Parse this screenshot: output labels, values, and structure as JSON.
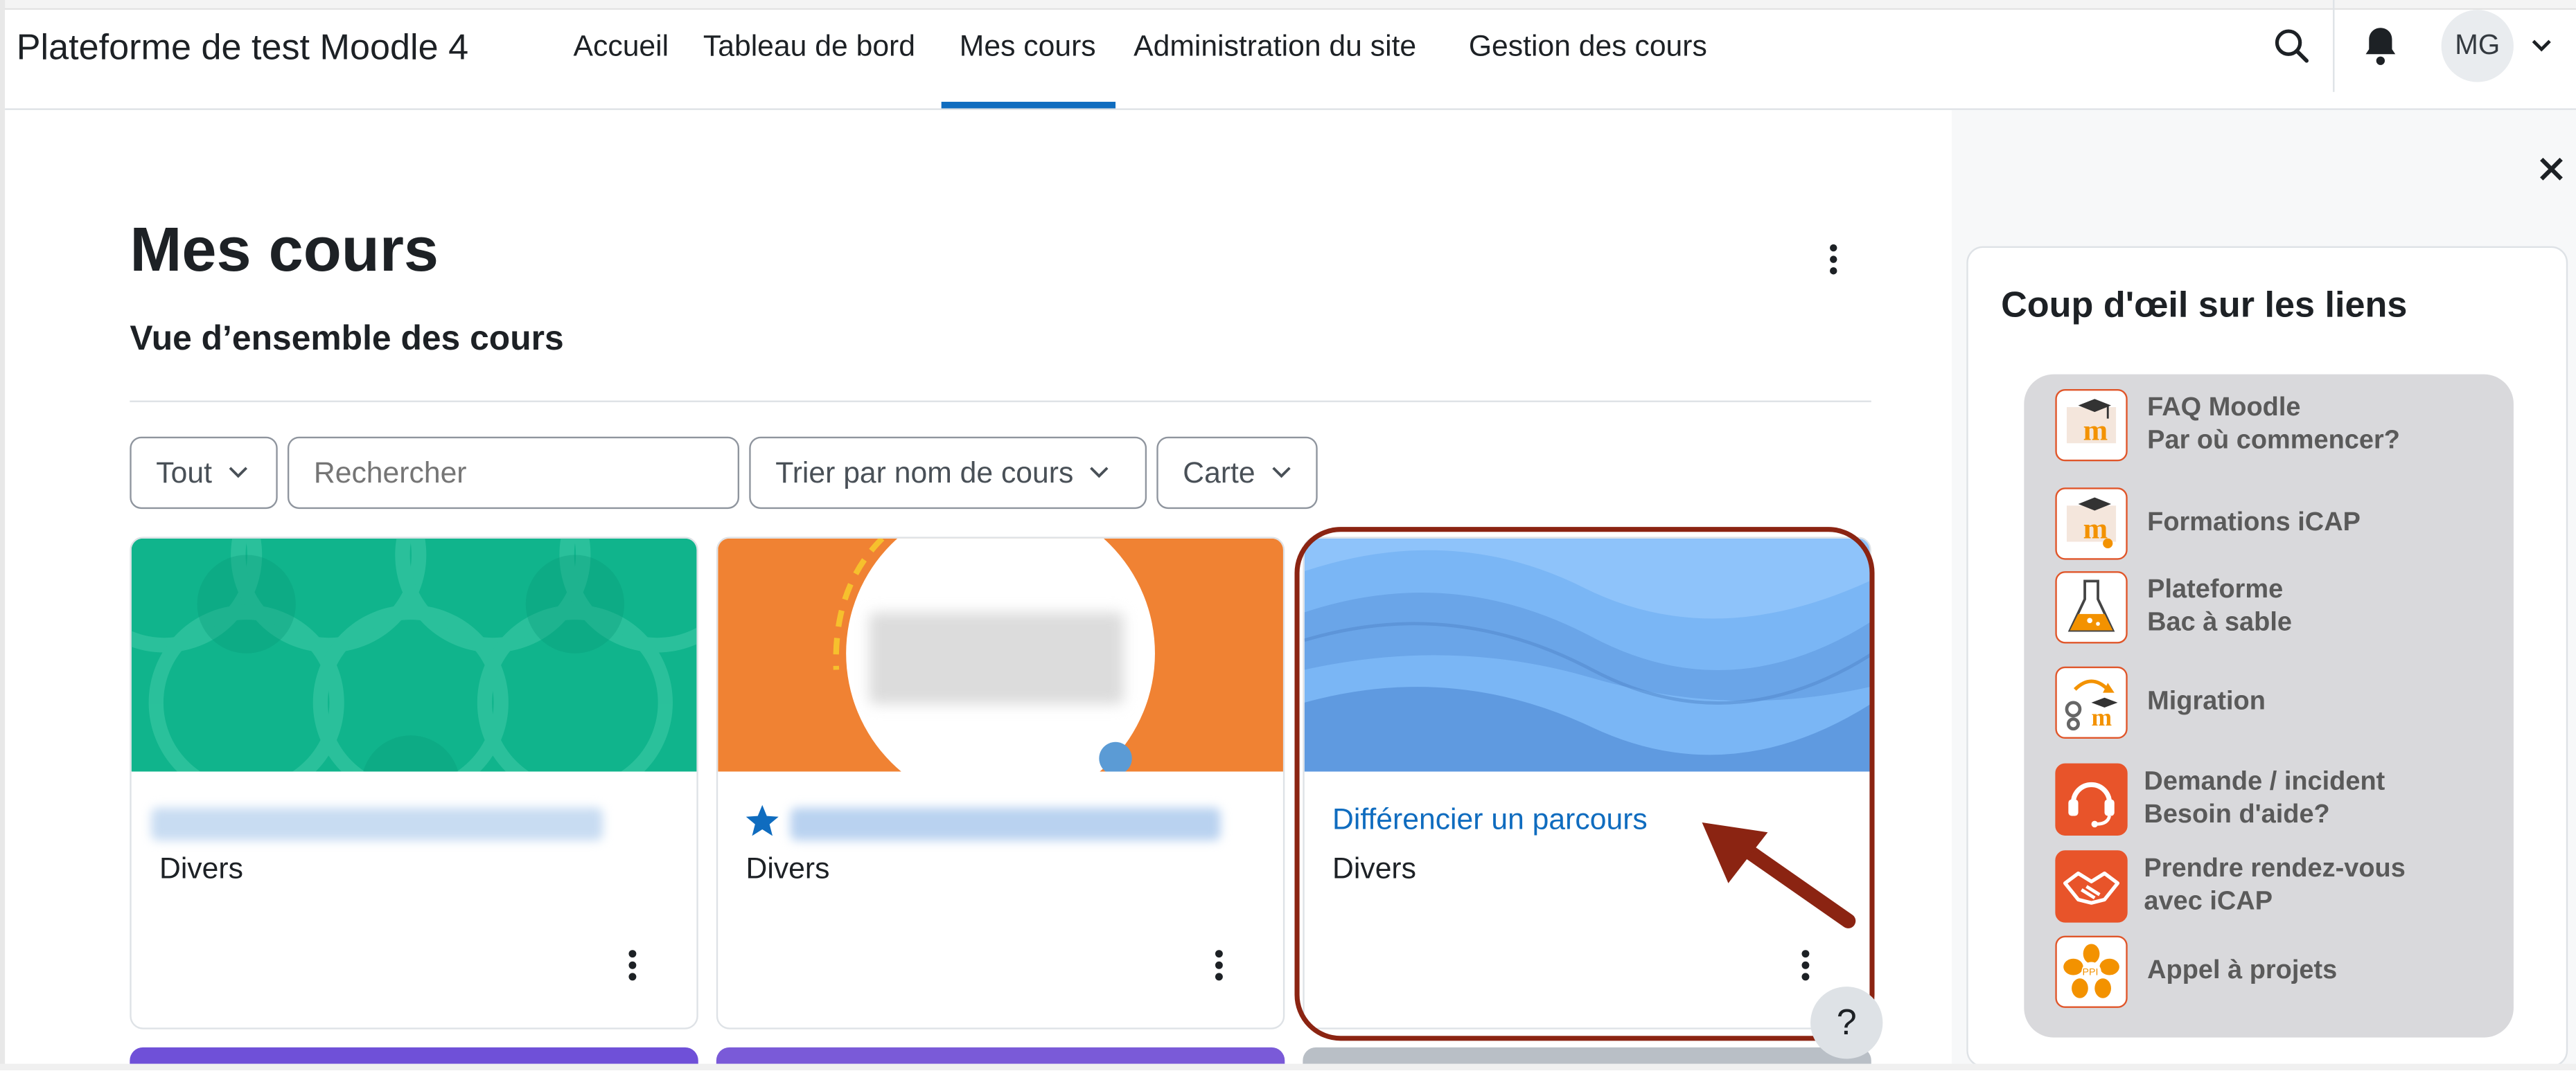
{
  "navbar": {
    "brand": "Plateforme de test Moodle 4",
    "items": [
      {
        "label": "Accueil"
      },
      {
        "label": "Tableau de bord"
      },
      {
        "label": "Mes cours",
        "active": true
      },
      {
        "label": "Administration du site"
      },
      {
        "label": "Gestion des cours"
      }
    ],
    "search_icon": "search-icon",
    "bell_icon": "bell-icon",
    "avatar_initials": "MG",
    "accent_color": "#0f6cbf"
  },
  "page": {
    "title": "Mes cours",
    "subtitle": "Vue d’ensemble des cours"
  },
  "filters": {
    "grouping": "Tout",
    "search_placeholder": "Rechercher",
    "sort": "Trier par nom de cours",
    "view": "Carte"
  },
  "courses": [
    {
      "title": "",
      "title_blurred": true,
      "category": "Divers",
      "starred": false,
      "image_color": "#10b48c"
    },
    {
      "title": "",
      "title_blurred": true,
      "category": "Divers",
      "starred": true,
      "image_color": "#f08233"
    },
    {
      "title": "Différencier un parcours",
      "title_blurred": false,
      "category": "Divers",
      "starred": false,
      "image_color": "#7ab6f5",
      "highlighted": true
    }
  ],
  "help_button": "?",
  "drawer": {
    "block_title": "Coup d'œil sur les liens",
    "links": [
      {
        "line1": "FAQ  Moodle",
        "line2": "Par où commencer?",
        "icon": "moodle-faq-icon"
      },
      {
        "line1": "Formations iCAP",
        "line2": "",
        "icon": "moodle-training-icon"
      },
      {
        "line1": "Plateforme",
        "line2": "Bac à sable",
        "icon": "flask-icon"
      },
      {
        "line1": "Migration",
        "line2": "",
        "icon": "migration-icon"
      },
      {
        "line1": "Demande / incident",
        "line2": "Besoin d'aide?",
        "icon": "headset-icon"
      },
      {
        "line1": "Prendre rendez-vous",
        "line2": "avec iCAP",
        "icon": "handshake-icon"
      },
      {
        "line1": "Appel à projets",
        "line2": "",
        "icon": "ppi-flower-icon"
      }
    ]
  }
}
